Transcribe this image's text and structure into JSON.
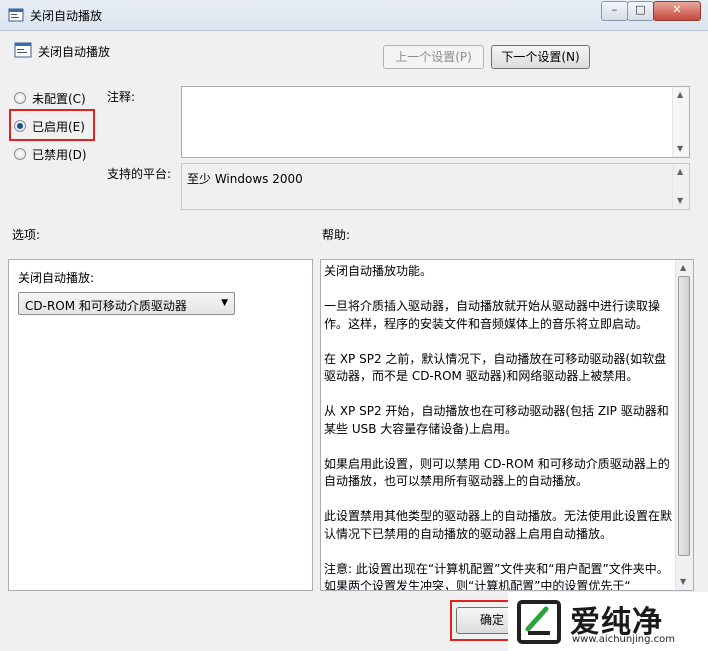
{
  "window": {
    "title": "关闭自动播放",
    "controls": {
      "minimize": "–",
      "maximize": "□",
      "close": "✕"
    }
  },
  "header": {
    "title": "关闭自动播放",
    "prev_label": "上一个设置(P)",
    "next_label": "下一个设置(N)"
  },
  "radios": {
    "unconfigured": "未配置(C)",
    "enabled": "已启用(E)",
    "disabled": "已禁用(D)",
    "selected": "enabled"
  },
  "comment": {
    "label": "注释:",
    "value": ""
  },
  "platform": {
    "label": "支持的平台:",
    "value": "至少 Windows 2000"
  },
  "options": {
    "label": "选项:",
    "autoplay_label": "关闭自动播放:",
    "selected_drive": "CD-ROM 和可移动介质驱动器"
  },
  "help": {
    "label": "帮助:",
    "paragraphs": [
      "关闭自动播放功能。",
      "一旦将介质插入驱动器，自动播放就开始从驱动器中进行读取操作。这样，程序的安装文件和音频媒体上的音乐将立即启动。",
      "在 XP SP2 之前，默认情况下，自动播放在可移动驱动器(如软盘驱动器，而不是 CD-ROM 驱动器)和网络驱动器上被禁用。",
      "从 XP SP2 开始，自动播放也在可移动驱动器(包括 ZIP 驱动器和某些 USB 大容量存储设备)上启用。",
      "如果启用此设置，则可以禁用 CD-ROM 和可移动介质驱动器上的自动播放，也可以禁用所有驱动器上的自动播放。",
      "此设置禁用其他类型的驱动器上的自动播放。无法使用此设置在默认情况下已禁用的自动播放的驱动器上启用自动播放。",
      "注意: 此设置出现在“计算机配置”文件夹和“用户配置”文件夹中。如果两个设置发生冲突，则“计算机配置”中的设置优先于“"
    ]
  },
  "footer": {
    "ok_label": "确定"
  },
  "watermark": {
    "brand": "爱纯净",
    "url": "www.aichunjing.com"
  },
  "colors": {
    "highlight": "#e0231f",
    "window_bg": "#f0f0f0"
  }
}
